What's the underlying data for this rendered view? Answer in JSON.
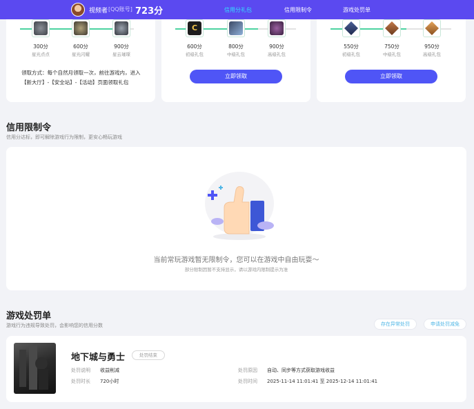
{
  "header": {
    "nickname": "视频者",
    "account_type": "[QQ账号]",
    "score": "723分",
    "nav": [
      {
        "label": "信用分礼包",
        "active": true
      },
      {
        "label": "信用限制令",
        "active": false
      },
      {
        "label": "游戏处罚单",
        "active": false
      }
    ]
  },
  "reward_cards": [
    {
      "tiers": [
        {
          "points": "300分",
          "name": "星光点点",
          "icon": "stone-medal-icon"
        },
        {
          "points": "600分",
          "name": "星光闪耀",
          "icon": "helmet-medal-icon"
        },
        {
          "points": "900分",
          "name": "星云璀璨",
          "icon": "armor-medal-icon"
        }
      ],
      "description": "领取方式：每个自然月领取一次，前往游戏内，进入【新大厅】-【安全站】-【活动】页面领取礼包"
    },
    {
      "tiers": [
        {
          "points": "600分",
          "name": "初级礼包",
          "icon": "c-badge-icon"
        },
        {
          "points": "800分",
          "name": "中级礼包",
          "icon": "card-icon"
        },
        {
          "points": "900分",
          "name": "高级礼包",
          "icon": "chest-icon"
        }
      ],
      "button": "立即领取"
    },
    {
      "tiers": [
        {
          "points": "550分",
          "name": "初级礼包",
          "icon": "rank-blue-icon"
        },
        {
          "points": "750分",
          "name": "中级礼包",
          "icon": "rank-bronze-icon"
        },
        {
          "points": "950分",
          "name": "高级礼包",
          "icon": "rank-gold-icon"
        }
      ],
      "button": "立即领取"
    }
  ],
  "restriction": {
    "title": "信用限制令",
    "subtitle": "信用分达标，即可解除游戏行为限制，更安心畅玩游戏",
    "empty_text": "当前常玩游戏暂无限制令，您可以在游戏中自由玩耍～",
    "empty_sub": "部分限制因暂不支持显示，请以游戏内限制提示为准"
  },
  "penalty": {
    "title": "游戏处罚单",
    "subtitle": "游戏行为违规导致处罚，会影响您的信用分数",
    "buttons": [
      "存在异常处罚",
      "申请处罚减免"
    ],
    "item": {
      "game": "地下城与勇士",
      "status": "处罚结束",
      "fields": [
        {
          "label": "处罚说明",
          "value": "收益削减"
        },
        {
          "label": "处罚时长",
          "value": "720小时"
        },
        {
          "label": "处罚原因",
          "value": "自动、同步等方式获取游戏收益"
        },
        {
          "label": "处罚时间",
          "value": "2025-11-14 11:01:41 至 2025-12-14 11:01:41"
        }
      ]
    }
  },
  "colors": {
    "primary": "#5b49f0",
    "button": "#4f55f6",
    "track": "#4cd3a0",
    "link": "#4fb6e6"
  }
}
